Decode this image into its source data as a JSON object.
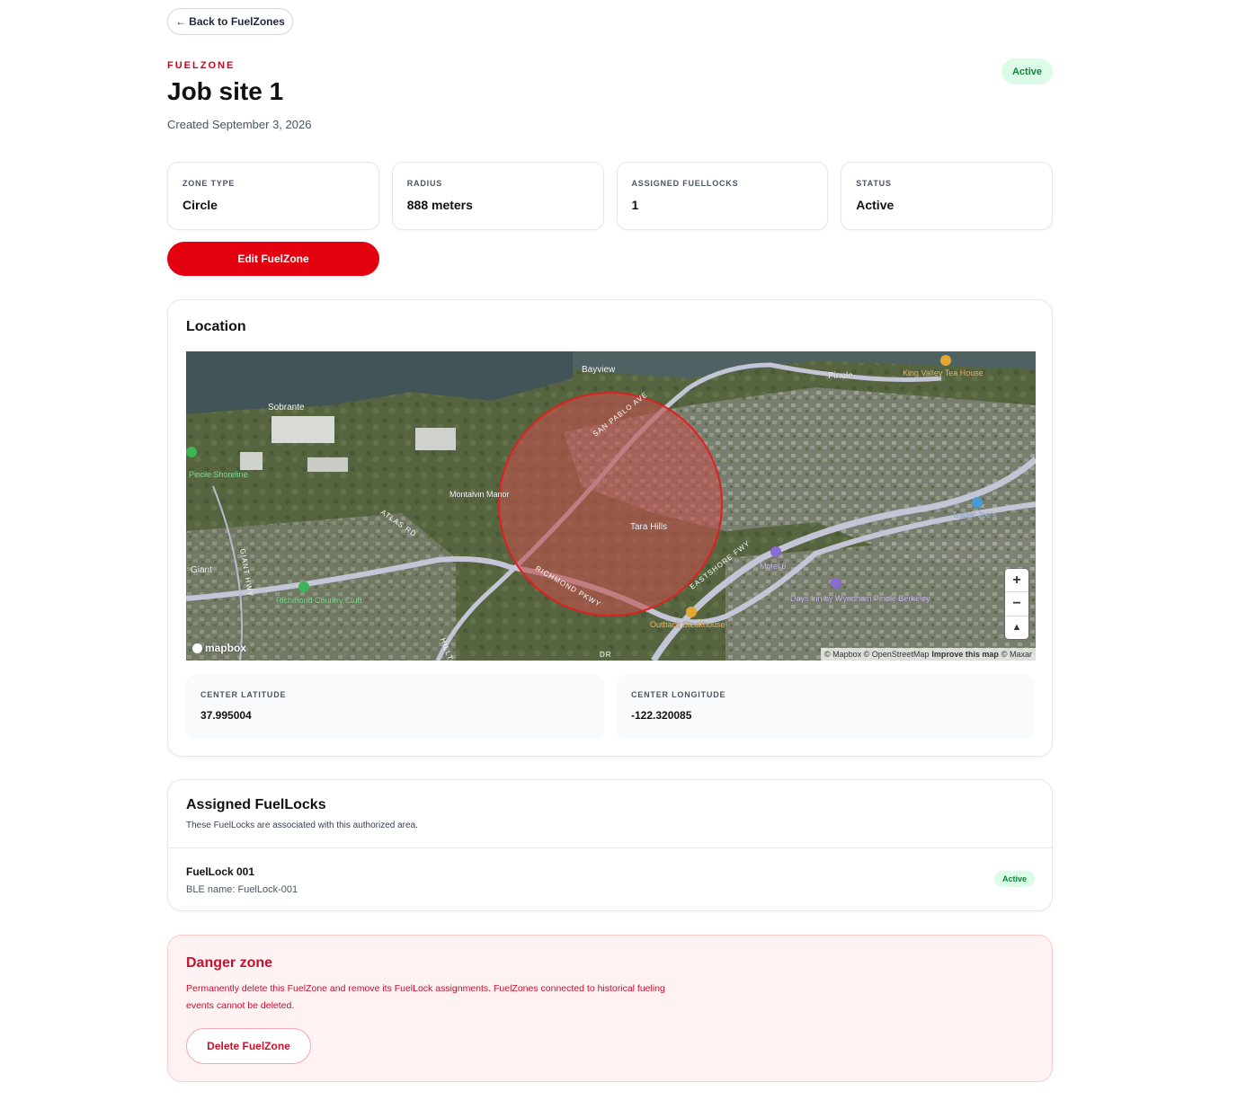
{
  "nav": {
    "back_arrow": "←",
    "back_label": "Back to FuelZones"
  },
  "header": {
    "eyebrow": "FUELZONE",
    "title": "Job site 1",
    "created": "Created September 3, 2026",
    "status_badge": "Active"
  },
  "stats": [
    {
      "label": "ZONE TYPE",
      "value": "Circle"
    },
    {
      "label": "RADIUS",
      "value": "888 meters"
    },
    {
      "label": "ASSIGNED FUELLOCKS",
      "value": "1"
    },
    {
      "label": "STATUS",
      "value": "Active"
    }
  ],
  "edit_button": "Edit FuelZone",
  "location": {
    "title": "Location",
    "map": {
      "place_labels": [
        "Bayview",
        "Pinole",
        "King Valley Tea House",
        "Sobrante",
        "Pinole Shoreline",
        "Montalvin Manor",
        "Tara Hills",
        "Trader Joe's",
        "Giant",
        "Richmond Country Club",
        "Motel 6",
        "Days Inn by Wyndham Pinole Berkeley",
        "Outback Steakhouse"
      ],
      "road_labels": [
        "SAN PABLO AVE",
        "ATLAS RD",
        "GIANT HWY",
        "RICHMOND PKWY",
        "EASTSHORE FWY",
        "HILLTO",
        "DR"
      ],
      "zoom_in": "+",
      "zoom_out": "−",
      "compass": "▲",
      "logo": "mapbox",
      "attribution": {
        "mapbox": "© Mapbox",
        "osm": "© OpenStreetMap",
        "improve": "Improve this map",
        "maxar": "© Maxar"
      },
      "zone_fill_color": "#c0504d",
      "zone_stroke_color": "#e02020"
    },
    "center_latitude_label": "CENTER LATITUDE",
    "center_latitude": "37.995004",
    "center_longitude_label": "CENTER LONGITUDE",
    "center_longitude": "-122.320085"
  },
  "assigned": {
    "title": "Assigned FuelLocks",
    "subtitle": "These FuelLocks are associated with this authorized area.",
    "items": [
      {
        "name": "FuelLock 001",
        "ble": "BLE name: FuelLock-001",
        "status": "Active"
      }
    ]
  },
  "danger": {
    "title": "Danger zone",
    "text": "Permanently delete this FuelZone and remove its FuelLock assignments. FuelZones connected to historical fueling events cannot be deleted.",
    "delete_label": "Delete FuelZone"
  },
  "colors": {
    "brand_red": "#e3000f",
    "success_bg": "#dcfce7",
    "success_text": "#15803d",
    "danger_bg": "#fef2f2"
  }
}
